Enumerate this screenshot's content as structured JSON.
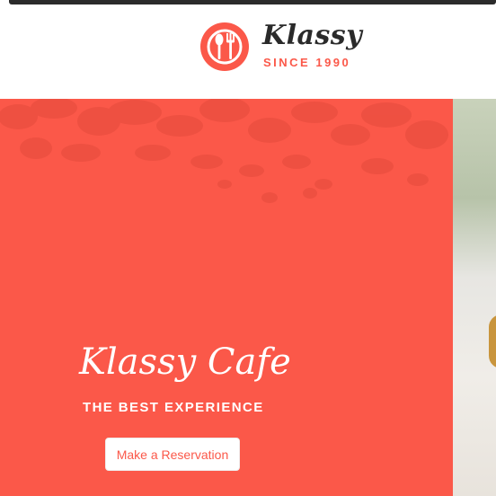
{
  "header": {
    "brand_name": "Klassy",
    "brand_tagline": "SINCE 1990",
    "logo_icon": "fork-spoon-icon"
  },
  "hero": {
    "title": "Klassy Cafe",
    "subtitle": "THE BEST EXPERIENCE",
    "cta_label": "Make a Reservation"
  },
  "colors": {
    "accent": "#fb5849",
    "text_dark": "#2a2a2a",
    "white": "#ffffff"
  }
}
